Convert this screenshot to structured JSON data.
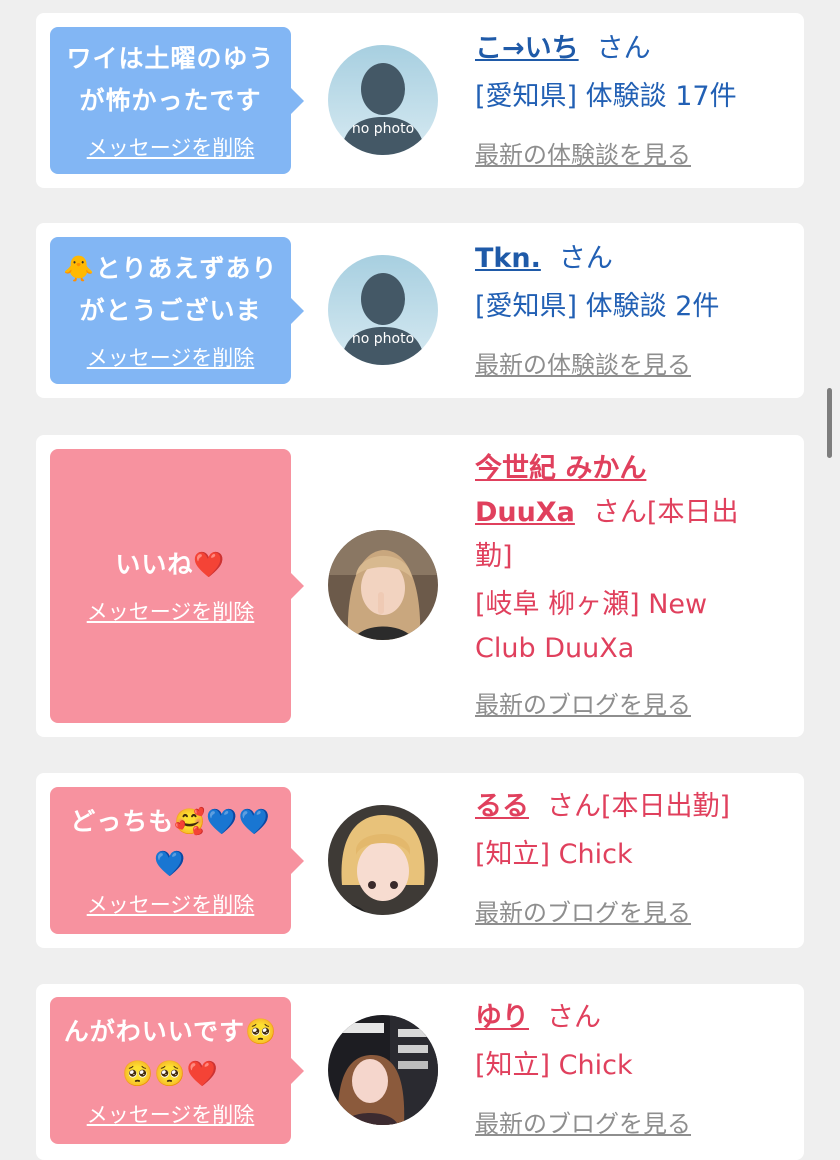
{
  "colors": {
    "blue_bubble": "#82b6f4",
    "pink_bubble": "#f7929f",
    "blue_text": "#2260b4",
    "pink_text": "#e0405d",
    "link_gray": "#8e8e8e"
  },
  "cards": [
    {
      "message_lines": [
        "ワイは土曜のゆう",
        "が怖かったです"
      ],
      "delete_label": "メッセージを削除",
      "avatar_icon": "no-photo-silhouette",
      "name": "こ→いち",
      "suffix": "さん",
      "detail_line": "[愛知県] 体験談 17件",
      "latest_link": "最新の体験談を見る"
    },
    {
      "message_lines": [
        "🐥とりあえずあり",
        "がとうございま"
      ],
      "delete_label": "メッセージを削除",
      "avatar_icon": "no-photo-silhouette",
      "name": "Tkn.",
      "suffix": "さん",
      "detail_line": "[愛知県] 体験談 2件",
      "latest_link": "最新の体験談を見る"
    },
    {
      "message_lines": [
        "いいね❤️"
      ],
      "delete_label": "メッセージを削除",
      "avatar_icon": "girl-photo",
      "name_line1": "今世紀 みかん",
      "name_line2": "DuuXa",
      "suffix_line2": "さん[本日出",
      "suffix_line3": "勤]",
      "shop_line1": "[岐阜 柳ヶ瀬] New",
      "shop_line2": "Club DuuXa",
      "latest_link": "最新のブログを見る"
    },
    {
      "message_lines": [
        "どっちも🥰💙💙",
        "💙"
      ],
      "delete_label": "メッセージを削除",
      "avatar_icon": "blonde-girl-photo",
      "name": "るる",
      "suffix": "さん[本日出勤]",
      "detail_line": "[知立] Chick",
      "latest_link": "最新のブログを見る"
    },
    {
      "message_lines": [
        "んがわいいです🥺",
        "🥺🥺❤️"
      ],
      "delete_label": "メッセージを削除",
      "avatar_icon": "magazine-girl-photo",
      "name": "ゆり",
      "suffix": "さん",
      "detail_line": "[知立] Chick",
      "latest_link": "最新のブログを見る"
    }
  ]
}
